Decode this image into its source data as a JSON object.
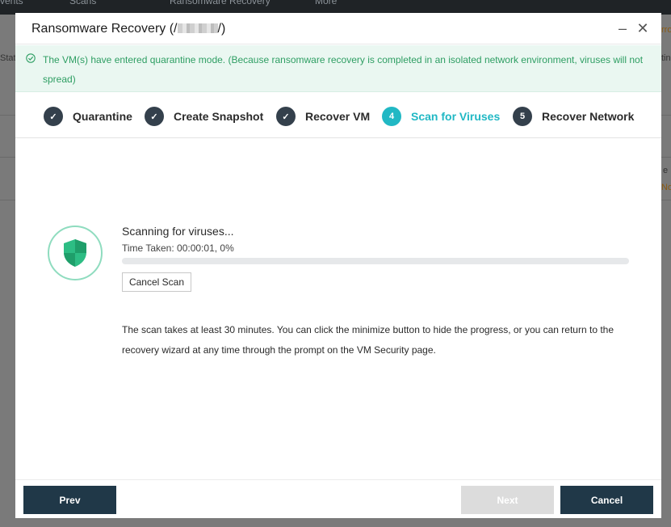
{
  "background": {
    "topbar_items": [
      "vents",
      "Scans",
      "Ransomware Recovery",
      "More"
    ],
    "left_partial_label": "Stat",
    "right_partial_labels": [
      "rro",
      "tin",
      "e",
      "No"
    ]
  },
  "dialog": {
    "title_prefix": "Ransomware Recovery (/",
    "title_suffix": "/)",
    "minimize_symbol": "–",
    "close_symbol": "✕",
    "notice": "The VM(s) have entered quarantine mode. (Because ransomware recovery is completed in an isolated network environment, viruses will not spread)",
    "steps": [
      {
        "label": "Quarantine",
        "marker": "✓",
        "state": "done"
      },
      {
        "label": "Create Snapshot",
        "marker": "✓",
        "state": "done"
      },
      {
        "label": "Recover VM",
        "marker": "✓",
        "state": "done"
      },
      {
        "label": "Scan for Viruses",
        "marker": "4",
        "state": "active"
      },
      {
        "label": "Recover Network",
        "marker": "5",
        "state": "pending"
      }
    ],
    "scan": {
      "title": "Scanning for viruses...",
      "time_taken": "Time Taken: 00:00:01, 0%",
      "progress_percent": 0,
      "cancel_label": "Cancel Scan"
    },
    "info": "The scan takes at least 30 minutes. You can click the minimize button to hide the progress, or you can return to the recovery wizard at any time through the prompt on the VM Security page.",
    "footer": {
      "prev_label": "Prev",
      "next_label": "Next",
      "cancel_label": "Cancel"
    }
  },
  "colors": {
    "accent": "#21b8c4",
    "success_text": "#2e9e63",
    "primary_button": "#203848",
    "step_done": "#34404c"
  }
}
